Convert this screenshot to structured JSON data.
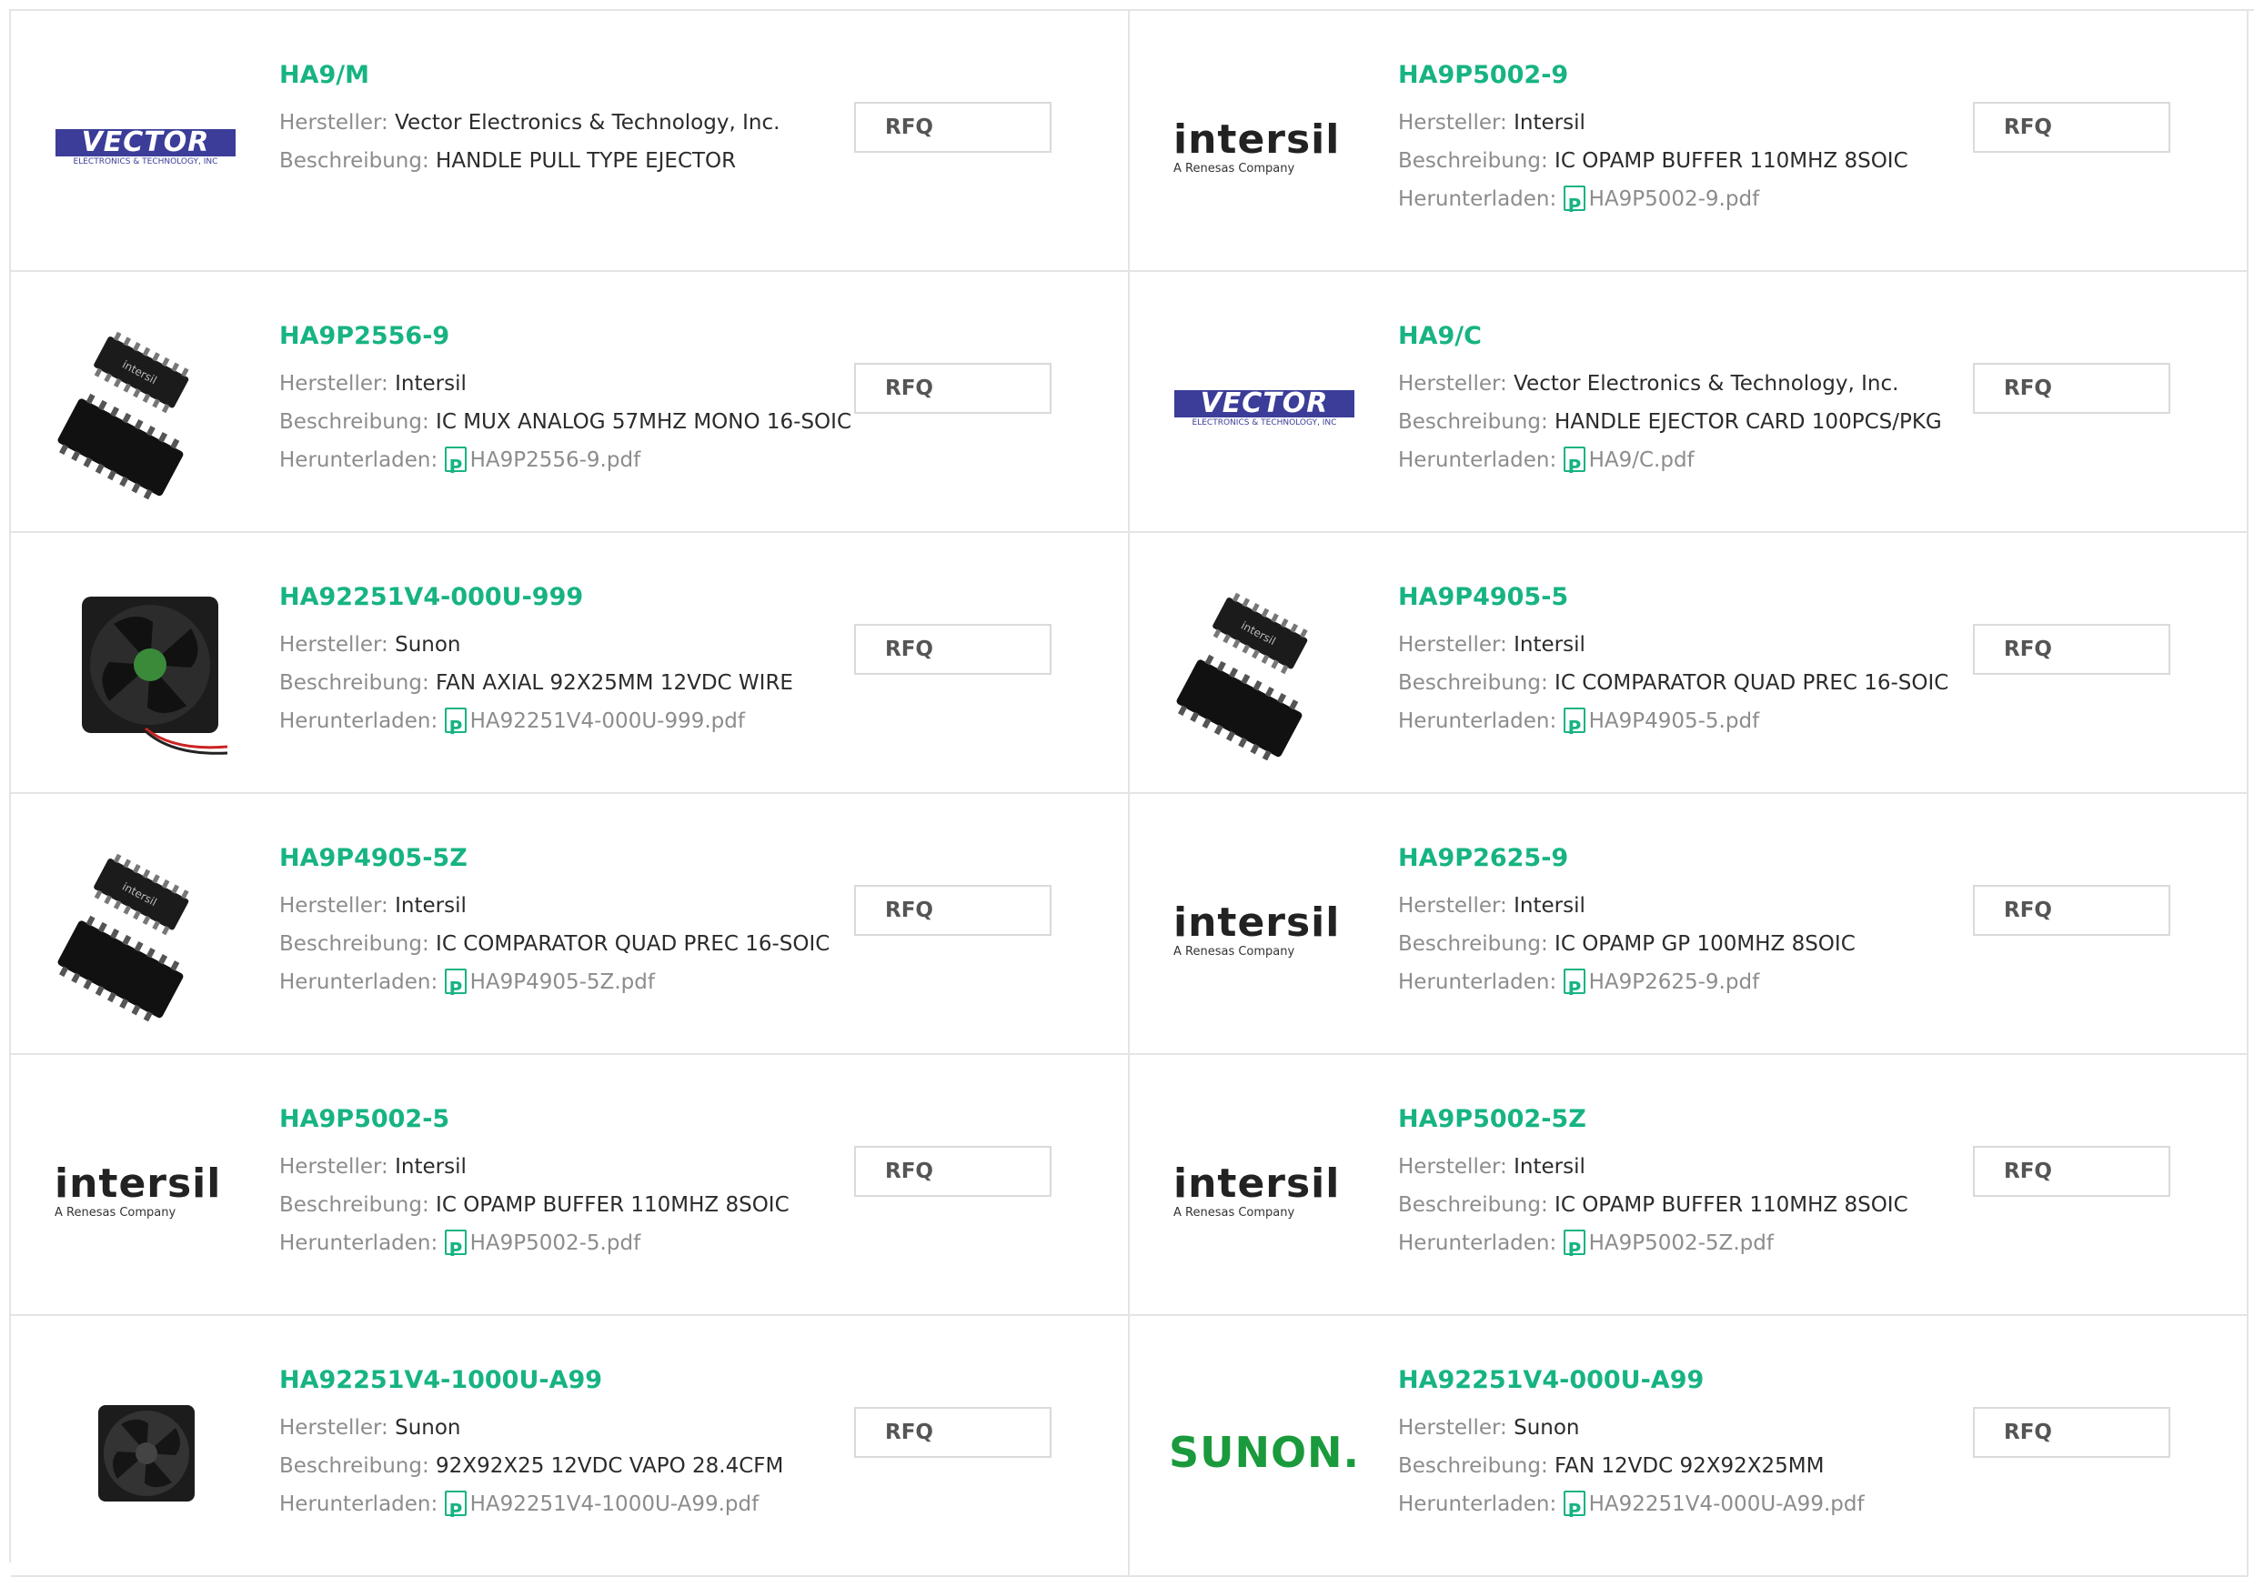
{
  "labels": {
    "manufacturer": "Hersteller:",
    "description": "Beschreibung:",
    "download": "Herunterladen:",
    "rfq": "RFQ"
  },
  "logos": {
    "vector": {
      "word": "VECTOR",
      "sub": "ELECTRONICS & TECHNOLOGY, INC"
    },
    "intersil": {
      "word": "intersil",
      "sub": "A Renesas Company"
    },
    "sunon": {
      "word": "SUNON."
    }
  },
  "products": [
    {
      "part": "HA9/M",
      "manufacturer": "Vector Electronics & Technology, Inc.",
      "description": "HANDLE PULL TYPE EJECTOR",
      "pdf": "",
      "image": "vector-logo"
    },
    {
      "part": "HA9P5002-9",
      "manufacturer": "Intersil",
      "description": "IC OPAMP BUFFER 110MHZ 8SOIC",
      "pdf": "HA9P5002-9.pdf",
      "image": "intersil-logo"
    },
    {
      "part": "HA9P2556-9",
      "manufacturer": "Intersil",
      "description": "IC MUX ANALOG 57MHZ MONO 16-SOIC",
      "pdf": "HA9P2556-9.pdf",
      "image": "soic-chip-photo"
    },
    {
      "part": "HA9/C",
      "manufacturer": "Vector Electronics & Technology, Inc.",
      "description": "HANDLE EJECTOR CARD 100PCS/PKG",
      "pdf": "HA9/C.pdf",
      "image": "vector-logo"
    },
    {
      "part": "HA92251V4-000U-999",
      "manufacturer": "Sunon",
      "description": "FAN AXIAL 92X25MM 12VDC WIRE",
      "pdf": "HA92251V4-000U-999.pdf",
      "image": "fan-photo"
    },
    {
      "part": "HA9P4905-5",
      "manufacturer": "Intersil",
      "description": "IC COMPARATOR QUAD PREC 16-SOIC",
      "pdf": "HA9P4905-5.pdf",
      "image": "soic-chip-photo"
    },
    {
      "part": "HA9P4905-5Z",
      "manufacturer": "Intersil",
      "description": "IC COMPARATOR QUAD PREC 16-SOIC",
      "pdf": "HA9P4905-5Z.pdf",
      "image": "soic-chip-photo"
    },
    {
      "part": "HA9P2625-9",
      "manufacturer": "Intersil",
      "description": "IC OPAMP GP 100MHZ 8SOIC",
      "pdf": "HA9P2625-9.pdf",
      "image": "intersil-logo"
    },
    {
      "part": "HA9P5002-5",
      "manufacturer": "Intersil",
      "description": "IC OPAMP BUFFER 110MHZ 8SOIC",
      "pdf": "HA9P5002-5.pdf",
      "image": "intersil-logo"
    },
    {
      "part": "HA9P5002-5Z",
      "manufacturer": "Intersil",
      "description": "IC OPAMP BUFFER 110MHZ 8SOIC",
      "pdf": "HA9P5002-5Z.pdf",
      "image": "intersil-logo"
    },
    {
      "part": "HA92251V4-1000U-A99",
      "manufacturer": "Sunon",
      "description": "92X92X25 12VDC VAPO 28.4CFM",
      "pdf": "HA92251V4-1000U-A99.pdf",
      "image": "fan-photo-small"
    },
    {
      "part": "HA92251V4-000U-A99",
      "manufacturer": "Sunon",
      "description": "FAN 12VDC 92X92X25MM",
      "pdf": "HA92251V4-000U-A99.pdf",
      "image": "sunon-logo"
    }
  ],
  "colors": {
    "accent": "#17b383",
    "border": "#e4e4e4",
    "vector": "#3b3d99",
    "sunon": "#1a9a3c"
  }
}
